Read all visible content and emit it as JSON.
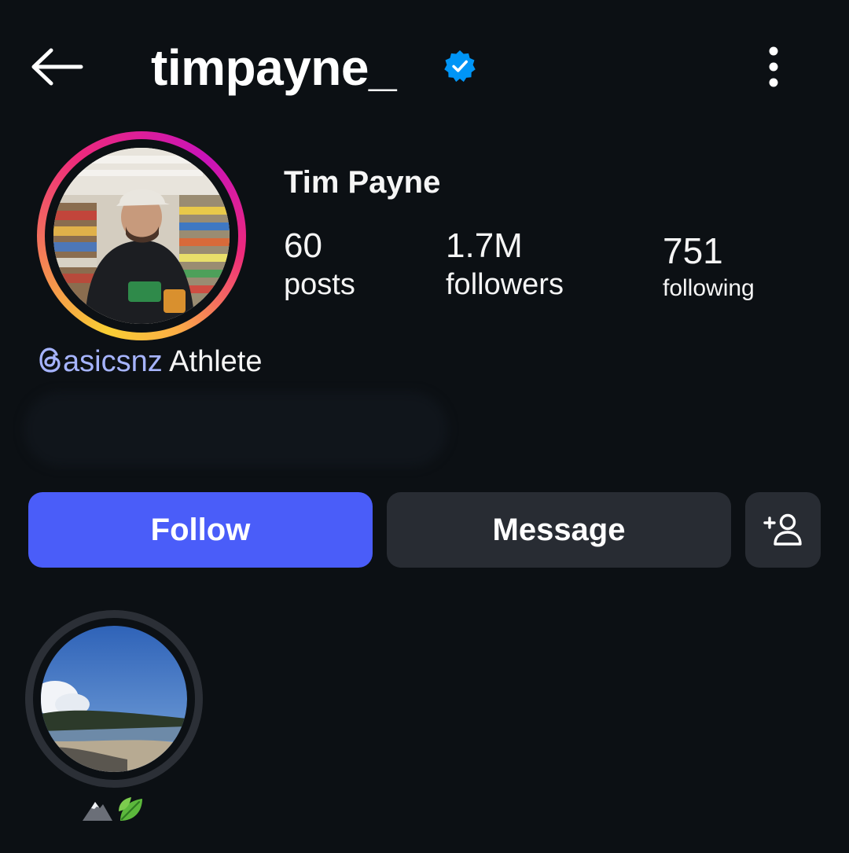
{
  "header": {
    "username": "timpayne_",
    "back_icon": "arrow-left-icon",
    "verified_icon": "verified-badge-icon",
    "more_icon": "more-vertical-icon"
  },
  "profile": {
    "full_name": "Tim Payne",
    "stats": {
      "posts": {
        "value": "60",
        "label": "posts"
      },
      "followers": {
        "value": "1.7M",
        "label": "followers"
      },
      "following": {
        "value": "751",
        "label": "following"
      }
    },
    "bio": {
      "link_icon": "threads-icon",
      "link_text": "asicsnz",
      "text": " Athlete"
    }
  },
  "actions": {
    "follow_label": "Follow",
    "message_label": "Message",
    "suggest_icon": "add-person-icon"
  },
  "highlights": [
    {
      "label_icons": [
        "mountain-emoji-icon",
        "leaf-emoji-icon"
      ]
    }
  ],
  "colors": {
    "background": "#0c1014",
    "follow_button": "#4a5df9",
    "secondary_button": "#282c33",
    "verified_blue": "#0095f6",
    "bio_link": "#a6b4ff"
  }
}
